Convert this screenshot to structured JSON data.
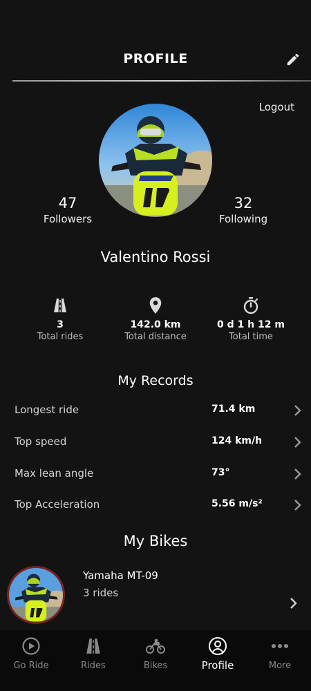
{
  "header": {
    "title": "PROFILE",
    "edit_icon": "pencil-icon"
  },
  "logout_label": "Logout",
  "profile": {
    "name": "Valentino Rossi",
    "followers_count": "47",
    "followers_label": "Followers",
    "following_count": "32",
    "following_label": "Following"
  },
  "summary": [
    {
      "icon": "road-icon",
      "value": "3",
      "label": "Total rides"
    },
    {
      "icon": "location-pin-icon",
      "value": "142.0 km",
      "label": "Total distance"
    },
    {
      "icon": "stopwatch-icon",
      "value": "0 d 1 h 12 m",
      "label": "Total time"
    }
  ],
  "records": {
    "title": "My Records",
    "rows": [
      {
        "label": "Longest ride",
        "value": "71.4 km"
      },
      {
        "label": "Top speed",
        "value": "124 km/h"
      },
      {
        "label": "Max lean angle",
        "value": "73°"
      },
      {
        "label": "Top Acceleration",
        "value": "5.56 m/s²"
      }
    ]
  },
  "bikes": {
    "title": "My Bikes",
    "items": [
      {
        "name": "Yamaha MT-09",
        "rides": "3 rides"
      }
    ]
  },
  "nav": [
    {
      "icon": "play-circle-icon",
      "label": "Go Ride",
      "active": false
    },
    {
      "icon": "road-icon",
      "label": "Rides",
      "active": false
    },
    {
      "icon": "motorcycle-icon",
      "label": "Bikes",
      "active": false
    },
    {
      "icon": "user-circle-icon",
      "label": "Profile",
      "active": true
    },
    {
      "icon": "more-dots-icon",
      "label": "More",
      "active": false
    }
  ],
  "colors": {
    "background": "#141314",
    "nav_background": "#0a0a0a",
    "bike_ring": "#7a2222",
    "inactive": "#8a8a8a"
  }
}
